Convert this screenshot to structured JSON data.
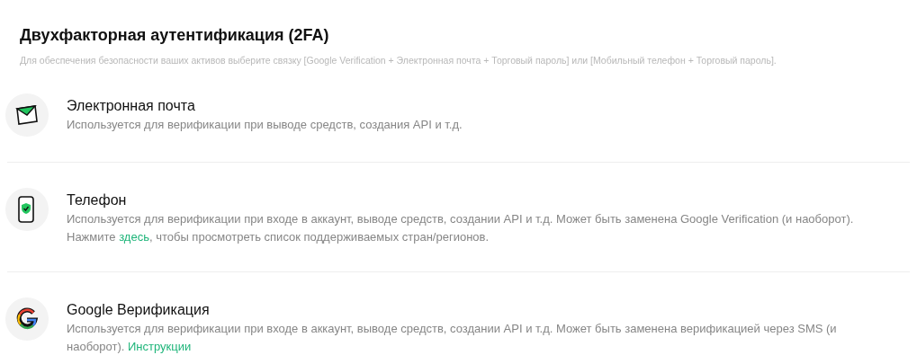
{
  "header": {
    "title": "Двухфакторная аутентификация (2FA)",
    "subtitle": "Для обеспечения безопасности ваших активов выберите связку [Google Verification + Электронная почта + Торговый пароль] или [Мобильный телефон + Торговый пароль]."
  },
  "methods": [
    {
      "kind": "email",
      "title": "Электронная почта",
      "description": [
        {
          "kind": "text",
          "text": "Используется для верификации при выводе средств, создания API и т.д."
        }
      ]
    },
    {
      "kind": "phone",
      "title": "Телефон",
      "description": [
        {
          "kind": "text",
          "text": "Используется для верификации при входе в аккаунт, выводе средств, создании API и т.д. Может быть заменена Google Verification (и наоборот). Нажмите "
        },
        {
          "kind": "link",
          "text": "здесь"
        },
        {
          "kind": "text",
          "text": ", чтобы просмотреть список поддерживаемых стран/регионов."
        }
      ]
    },
    {
      "kind": "google",
      "title": "Google Верификация",
      "description": [
        {
          "kind": "text",
          "text": "Используется для верификации при входе в аккаунт, выводе средств, создании API и т.д. Может быть заменена верификацией через SMS (и наоборот). "
        },
        {
          "kind": "link",
          "text": "Инструкции"
        }
      ]
    }
  ]
}
